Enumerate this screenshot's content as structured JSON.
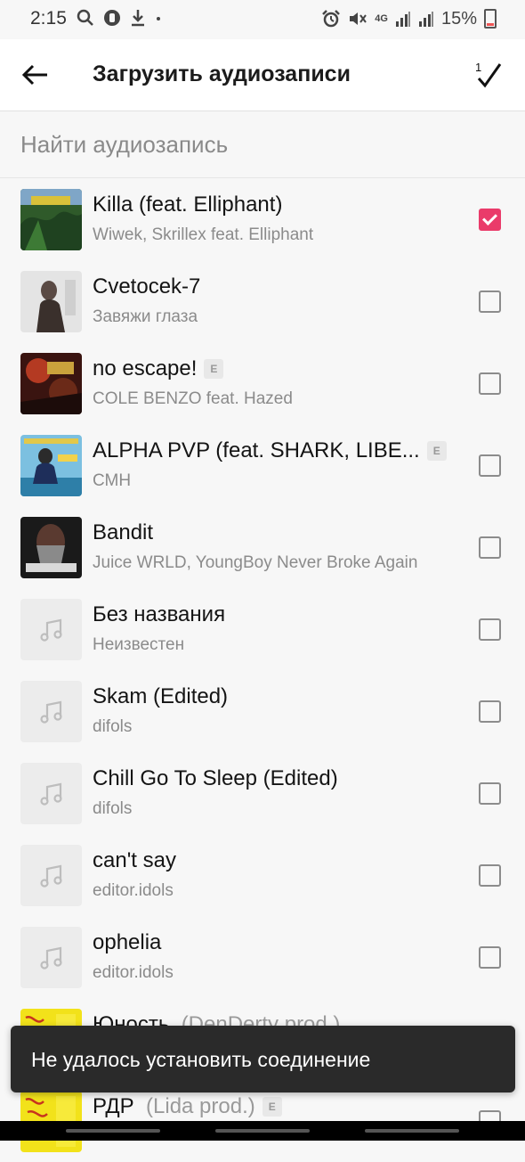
{
  "status_bar": {
    "time": "2:15",
    "battery": "15%",
    "network": "4G"
  },
  "header": {
    "title": "Загрузить аудиозаписи",
    "selected_count": "1"
  },
  "search": {
    "placeholder": "Найти аудиозапись"
  },
  "tracks": [
    {
      "title": "Killa (feat. Elliphant)",
      "extra": "",
      "explicit": false,
      "artist": "Wiwek, Skrillex feat. Elliphant",
      "checked": true
    },
    {
      "title": "Cvetocek-7",
      "extra": "",
      "explicit": false,
      "artist": "Завяжи глаза",
      "checked": false
    },
    {
      "title": "no escape!",
      "extra": "",
      "explicit": true,
      "artist": "COLE BENZO feat. Hazed",
      "checked": false
    },
    {
      "title": "ALPHA PVP (feat. SHARK, LIBE...",
      "extra": "",
      "explicit": true,
      "artist": "СМН",
      "checked": false
    },
    {
      "title": "Bandit",
      "extra": "",
      "explicit": false,
      "artist": "Juice WRLD, YoungBoy Never Broke Again",
      "checked": false
    },
    {
      "title": "Без названия",
      "extra": "",
      "explicit": false,
      "artist": "Неизвестен",
      "checked": false
    },
    {
      "title": "Skam (Edited)",
      "extra": "",
      "explicit": false,
      "artist": "difols",
      "checked": false
    },
    {
      "title": "Chill Go To Sleep (Edited)",
      "extra": "",
      "explicit": false,
      "artist": "difols",
      "checked": false
    },
    {
      "title": "can't say",
      "extra": "",
      "explicit": false,
      "artist": "editor.idols",
      "checked": false
    },
    {
      "title": "ophelia",
      "extra": "",
      "explicit": false,
      "artist": "editor.idols",
      "checked": false
    },
    {
      "title": "Юность",
      "extra": "(DenDerty prod.)",
      "explicit": false,
      "artist": "",
      "checked": false
    },
    {
      "title": "РДР",
      "extra": "(Lida prod.)",
      "explicit": true,
      "artist": "",
      "checked": false
    }
  ],
  "explicit_label": "E",
  "toast": {
    "message": "Не удалось установить соединение"
  },
  "colors": {
    "accent": "#ea3b6a",
    "toast_bg": "#2a2a2a"
  },
  "icons": {
    "back": "arrow-left-icon",
    "done": "checkmark-icon",
    "placeholder_cover": "music-note-icon"
  }
}
